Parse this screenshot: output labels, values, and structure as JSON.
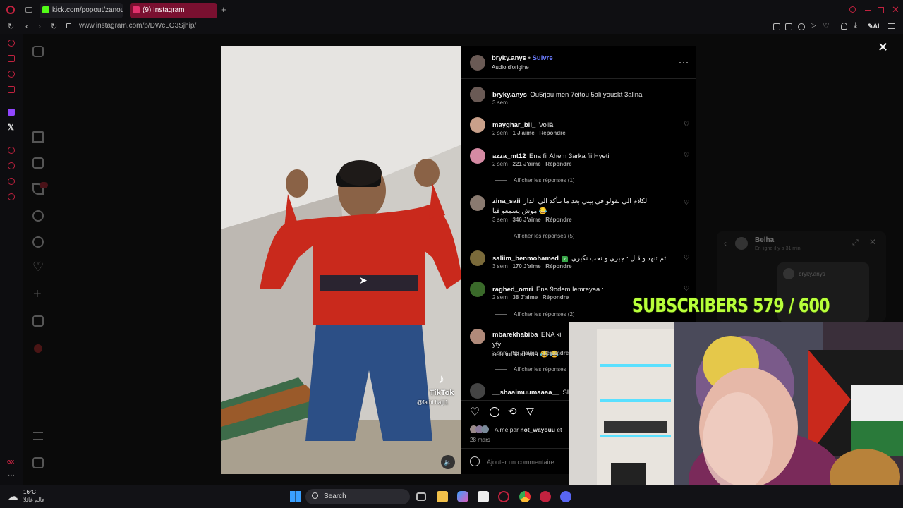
{
  "browser": {
    "tabs": [
      {
        "label": "kick.com/popout/zanoun/"
      },
      {
        "label": "(9) Instagram"
      }
    ],
    "url": "www.instagram.com/p/DWcLO3Sjhip/",
    "ai_label": "AI"
  },
  "post": {
    "author": "bryky.anys",
    "follow_label": "Suivre",
    "audio": "Audio d'origine",
    "watermark": "TikTok",
    "watermark_handle": "@fathi.hajji1",
    "caption": {
      "user": "bryky.anys",
      "text": "Ou5rjou men 7eitou 5ali youskt 3alina",
      "time": "3 sem"
    },
    "comments": [
      {
        "user": "mayghar bii_",
        "display_user": "mayghar_bii_",
        "text": "Voilà",
        "time": "2 sem",
        "likes": "1 J'aime",
        "reply": "Répondre",
        "replies": ""
      },
      {
        "user": "azza_mt12",
        "text": "Ena fii Ahem 3arka fii Hyetii",
        "time": "2 sem",
        "likes": "221 J'aime",
        "reply": "Répondre",
        "replies": "Afficher les réponses (1)"
      },
      {
        "user": "zina_saii",
        "text": "الكلام الي نقولو في بيتي بعد ما نتأكد الي الدار موش يسمعو فيا 😂",
        "time": "3 sem",
        "likes": "346 J'aime",
        "reply": "Répondre",
        "replies": "Afficher les réponses (5)"
      },
      {
        "user": "saliim_benmohamed",
        "text": "ثم تنهد و قال : جبري و نحب نكبري",
        "time": "3 sem",
        "likes": "170 J'aime",
        "reply": "Répondre",
        "replies": ""
      },
      {
        "user": "raghed_omri",
        "text": "Ena 9odem lemreyaa :",
        "time": "2 sem",
        "likes": "38 J'aime",
        "reply": "Répondre",
        "replies": "Afficher les réponses (2)"
      },
      {
        "user": "mbarekhabiba",
        "text": "ENA ki yfy",
        "text2": "nchouf khdema 😂 😂",
        "time": "3 sem",
        "likes": "55 J'aime",
        "reply": "Répondre",
        "replies": "Afficher les réponses"
      },
      {
        "user": "__shaaimuumaaaa__",
        "text": "Slat a",
        "time": "",
        "likes": "",
        "reply": "",
        "replies": ""
      }
    ],
    "liked_by_prefix": "Aimé par",
    "liked_by_user": "not_wayouu",
    "liked_by_suffix": "et",
    "date": "28 mars",
    "comment_placeholder": "Ajouter un commentaire..."
  },
  "chat_popup": {
    "name": "Belha",
    "status": "En ligne il y a 31 min",
    "preview": "bryky.anys"
  },
  "stream_overlay": {
    "subscribers": "SUBSCRIBERS 579 / 600"
  },
  "taskbar": {
    "weather_temp": "16°C",
    "weather_desc": "عالم غائلا",
    "search_label": "Search"
  },
  "colors": {
    "accent": "#c2223f",
    "instagram_blue": "#4a5df9",
    "subs_green": "#b8ff3a"
  }
}
